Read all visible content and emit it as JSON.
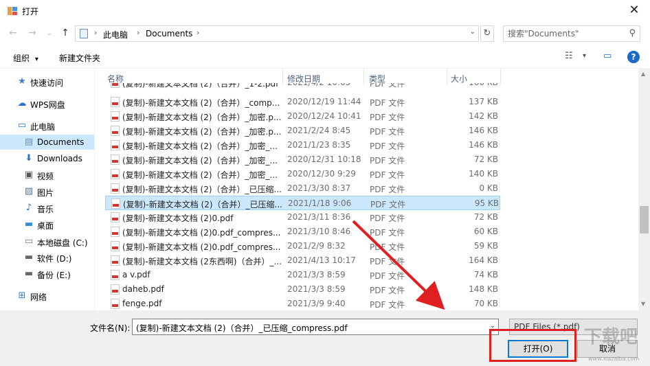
{
  "window": {
    "title": "打开",
    "close_glyph": "✕"
  },
  "address": {
    "back_glyph": "←",
    "forward_glyph": "→",
    "recent_glyph": "⌄",
    "up_glyph": "↑",
    "crumbs": [
      "此电脑",
      "Documents"
    ],
    "separator_glyph": "›",
    "dropdown_glyph": "⌄",
    "refresh_glyph": "↻",
    "search_placeholder": "搜索\"Documents\"",
    "search_glyph": "⚲"
  },
  "toolbar": {
    "organize_label": "组织",
    "organize_caret": "▾",
    "new_folder_label": "新建文件夹",
    "view_glyph": "☷",
    "view_caret": "▾",
    "preview_glyph": "▭",
    "help_glyph": "?"
  },
  "sidebar": {
    "items": [
      {
        "label": "快速访问",
        "icon": "star-icon",
        "glyph": "★",
        "color": "#3c7fd0"
      },
      {
        "label": "WPS网盘",
        "icon": "cloud-icon",
        "glyph": "☁",
        "color": "#2f6fd6"
      },
      {
        "label": "此电脑",
        "icon": "computer-icon",
        "glyph": "▭",
        "color": "#2e7bcf"
      },
      {
        "label": "Documents",
        "icon": "documents-icon",
        "glyph": "▤",
        "color": "#6b8fb3",
        "selected": true
      },
      {
        "label": "Downloads",
        "icon": "download-icon",
        "glyph": "⬇",
        "color": "#2b76cc"
      },
      {
        "label": "视频",
        "icon": "video-icon",
        "glyph": "▣",
        "color": "#555555"
      },
      {
        "label": "图片",
        "icon": "pictures-icon",
        "glyph": "▨",
        "color": "#557799"
      },
      {
        "label": "音乐",
        "icon": "music-icon",
        "glyph": "♪",
        "color": "#1f6fc6"
      },
      {
        "label": "桌面",
        "icon": "desktop-icon",
        "glyph": "▬",
        "color": "#2b8fd9"
      },
      {
        "label": "本地磁盘 (C:)",
        "icon": "drive-c-icon",
        "glyph": "▭",
        "color": "#777777"
      },
      {
        "label": "软件 (D:)",
        "icon": "drive-d-icon",
        "glyph": "▬",
        "color": "#666666"
      },
      {
        "label": "备份 (E:)",
        "icon": "drive-e-icon",
        "glyph": "▬",
        "color": "#666666"
      },
      {
        "label": "网络",
        "icon": "network-icon",
        "glyph": "⊞",
        "color": "#2d7dd2"
      }
    ]
  },
  "columns": {
    "name": "名称",
    "sort_glyph": "^",
    "modified": "修改日期",
    "type": "类型",
    "size": "大小"
  },
  "files": [
    {
      "name": "(复制)-新建文本文档 (2)（合并）_1-2.pdf",
      "date": "2021/4/2 10:05",
      "type": "PDF 文件",
      "size": "160 KB",
      "partial": true
    },
    {
      "name": "(复制)-新建文本文档 (2)（合并）_comp...",
      "date": "2020/12/19 11:44",
      "type": "PDF 文件",
      "size": "137 KB"
    },
    {
      "name": "(复制)-新建文本文档 (2)（合并）_加密.p...",
      "date": "2020/12/24 10:41",
      "type": "PDF 文件",
      "size": "142 KB"
    },
    {
      "name": "(复制)-新建文本文档 (2)（合并）_加密.p...",
      "date": "2021/2/24 8:45",
      "type": "PDF 文件",
      "size": "146 KB"
    },
    {
      "name": "(复制)-新建文本文档 (2)（合并）_加密_...",
      "date": "2021/1/23 8:35",
      "type": "PDF 文件",
      "size": "146 KB"
    },
    {
      "name": "(复制)-新建文本文档 (2)（合并）_加密_...",
      "date": "2020/12/31 10:18",
      "type": "PDF 文件",
      "size": "72 KB"
    },
    {
      "name": "(复制)-新建文本文档 (2)（合并）_加密_...",
      "date": "2020/12/30 9:29",
      "type": "PDF 文件",
      "size": "140 KB"
    },
    {
      "name": "(复制)-新建文本文档 (2)（合并）_已压缩...",
      "date": "2021/3/30 8:37",
      "type": "PDF 文件",
      "size": "0 KB"
    },
    {
      "name": "(复制)-新建文本文档 (2)（合并）_已压缩...",
      "date": "2021/1/18 9:06",
      "type": "PDF 文件",
      "size": "95 KB",
      "selected": true
    },
    {
      "name": "(复制)-新建文本文档 (2)0.pdf",
      "date": "2021/3/11 8:36",
      "type": "PDF 文件",
      "size": "72 KB"
    },
    {
      "name": "(复制)-新建文本文档 (2)0.pdf_compres...",
      "date": "2021/3/10 8:46",
      "type": "PDF 文件",
      "size": "60 KB"
    },
    {
      "name": "(复制)-新建文本文档 (2)0.pdf_compres...",
      "date": "2021/2/9 8:32",
      "type": "PDF 文件",
      "size": "59 KB"
    },
    {
      "name": "(复制)-新建文本文档 (2东西啊)（合并）_...",
      "date": "2021/4/13 10:17",
      "type": "PDF 文件",
      "size": "164 KB"
    },
    {
      "name": "a v.pdf",
      "date": "2021/3/3 8:59",
      "type": "PDF 文件",
      "size": "74 KB"
    },
    {
      "name": "daheb.pdf",
      "date": "2021/3/3 8:59",
      "type": "PDF 文件",
      "size": "148 KB"
    },
    {
      "name": "fenge.pdf",
      "date": "2021/3/9 9:40",
      "type": "PDF 文件",
      "size": "70 KB"
    }
  ],
  "scrollbar": {
    "up_glyph": "▲",
    "down_glyph": "▼"
  },
  "bottom": {
    "filename_label": "文件名(N):",
    "filename_value": "(复制)-新建文本文档 (2)（合并）_已压缩_compress.pdf",
    "filename_dd_glyph": "⌄",
    "filetype_value": "PDF Files (*.pdf)",
    "open_label": "打开(O)",
    "cancel_label": "取消"
  },
  "watermark": {
    "text": "下载吧",
    "sub": "www.xiazaiba.com"
  },
  "colors": {
    "selection": "#cce8ff",
    "selection_border": "#99d1ff",
    "annotation": "#e02020",
    "accent": "#0078d7"
  }
}
